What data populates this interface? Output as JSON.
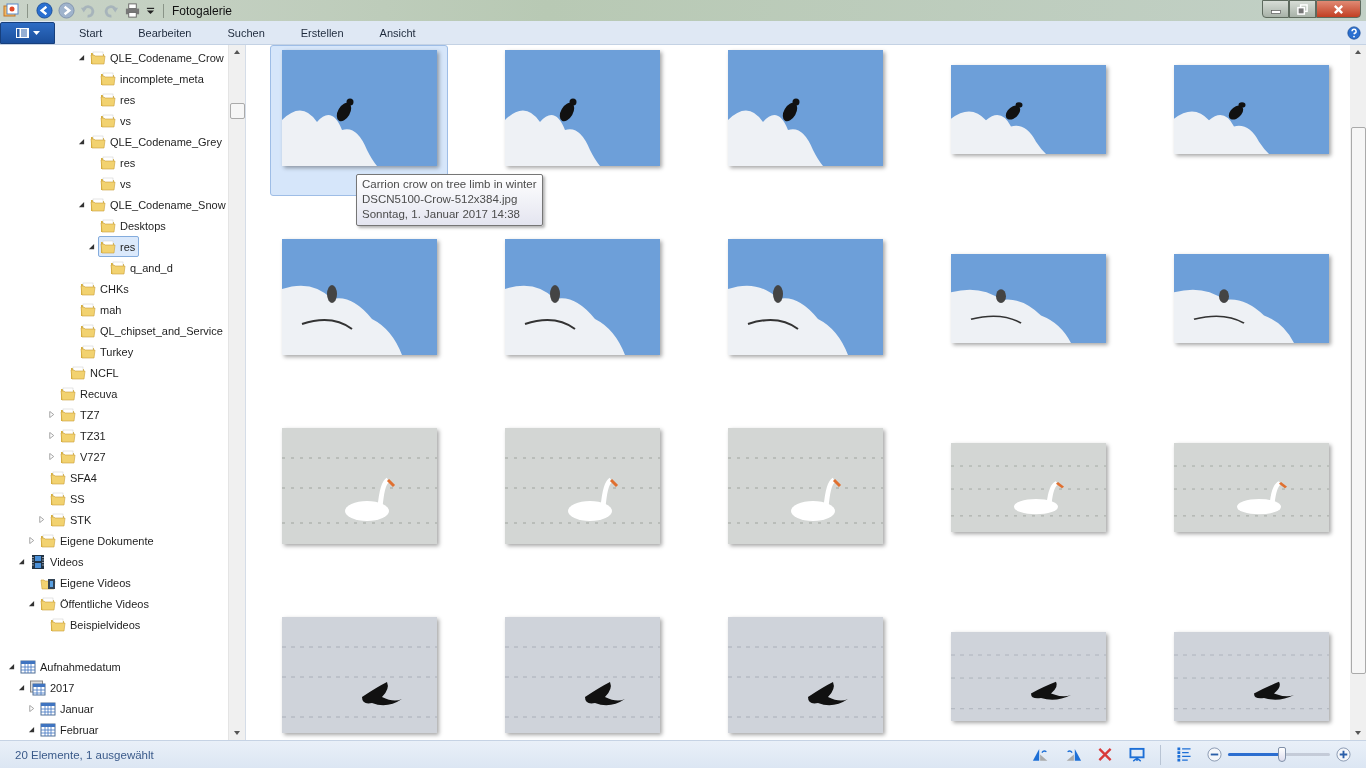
{
  "window": {
    "title": "Fotogalerie"
  },
  "menu": [
    "Start",
    "Bearbeiten",
    "Suchen",
    "Erstellen",
    "Ansicht"
  ],
  "sidebar": {
    "sections": [
      {
        "items": [
          {
            "children": [
              {
                "children": [
                  {
                    "children": [
                      {
                        "children": [
                          {
                            "children": [
                              {
                                "children": [
                                  {
                                    "children": [
                                      {
                                        "label": "QLE_Codename_Crow",
                                        "kind": "folder",
                                        "expanded": true,
                                        "selected": false,
                                        "children": [
                                          {
                                            "label": "incomplete_meta",
                                            "kind": "folder",
                                            "selected": false
                                          },
                                          {
                                            "label": "res",
                                            "kind": "folder",
                                            "selected": false
                                          },
                                          {
                                            "label": "vs",
                                            "kind": "folder",
                                            "selected": false
                                          }
                                        ]
                                      },
                                      {
                                        "label": "QLE_Codename_Grey",
                                        "kind": "folder",
                                        "expanded": true,
                                        "selected": false,
                                        "children": [
                                          {
                                            "label": "res",
                                            "kind": "folder",
                                            "selected": false
                                          },
                                          {
                                            "label": "vs",
                                            "kind": "folder",
                                            "selected": false
                                          }
                                        ]
                                      },
                                      {
                                        "label": "QLE_Codename_Snow",
                                        "kind": "folder",
                                        "expanded": true,
                                        "selected": false,
                                        "children": [
                                          {
                                            "label": "Desktops",
                                            "kind": "folder",
                                            "selected": false
                                          },
                                          {
                                            "label": "res",
                                            "kind": "folder",
                                            "expanded": true,
                                            "selected": true,
                                            "children": [
                                              {
                                                "label": "q_and_d",
                                                "kind": "folder",
                                                "selected": false
                                              }
                                            ]
                                          }
                                        ]
                                      }
                                    ]
                                  },
                                  {
                                    "label": "CHKs",
                                    "kind": "folder",
                                    "selected": false
                                  },
                                  {
                                    "label": "mah",
                                    "kind": "folder",
                                    "selected": false
                                  },
                                  {
                                    "label": "QL_chipset_and_Service",
                                    "kind": "folder",
                                    "selected": false
                                  },
                                  {
                                    "label": "Turkey",
                                    "kind": "folder",
                                    "selected": false
                                  }
                                ]
                              },
                              {
                                "label": "NCFL",
                                "kind": "folder",
                                "selected": false
                              }
                            ]
                          },
                          {
                            "label": "Recuva",
                            "kind": "folder",
                            "selected": false
                          },
                          {
                            "label": "TZ7",
                            "kind": "folder",
                            "expanded": false,
                            "selected": false
                          },
                          {
                            "label": "TZ31",
                            "kind": "folder",
                            "expanded": false,
                            "selected": false
                          },
                          {
                            "label": "V727",
                            "kind": "folder",
                            "expanded": false,
                            "selected": false
                          }
                        ]
                      },
                      {
                        "label": "SFA4",
                        "kind": "folder",
                        "selected": false
                      },
                      {
                        "label": "SS",
                        "kind": "folder",
                        "selected": false
                      },
                      {
                        "label": "STK",
                        "kind": "folder",
                        "expanded": false,
                        "selected": false
                      }
                    ]
                  },
                  {
                    "label": "Eigene Dokumente",
                    "kind": "folder",
                    "expanded": false,
                    "selected": false
                  }
                ]
              },
              {
                "label": "Videos",
                "kind": "video-library",
                "expanded": true,
                "selected": false,
                "children": [
                  {
                    "label": "Eigene Videos",
                    "kind": "video-folder",
                    "selected": false
                  },
                  {
                    "label": "Öffentliche Videos",
                    "kind": "folder",
                    "expanded": true,
                    "selected": false,
                    "children": [
                      {
                        "label": "Beispielvideos",
                        "kind": "folder",
                        "selected": false
                      }
                    ]
                  }
                ]
              }
            ]
          }
        ]
      },
      {
        "items": [
          {
            "label": "Aufnahmedatum",
            "kind": "calendar",
            "expanded": true,
            "selected": false,
            "children": [
              {
                "label": "2017",
                "kind": "calendar-stack",
                "expanded": true,
                "selected": false,
                "children": [
                  {
                    "label": "Januar",
                    "kind": "calendar",
                    "expanded": false,
                    "selected": false
                  },
                  {
                    "label": "Februar",
                    "kind": "calendar",
                    "expanded": true,
                    "selected": false
                  }
                ]
              }
            ]
          }
        ]
      }
    ]
  },
  "gallery": {
    "items": [
      {
        "kind": "crow-tree",
        "selected": true
      },
      {
        "kind": "crow-tree",
        "selected": false
      },
      {
        "kind": "crow-tree",
        "selected": false
      },
      {
        "kind": "crow-tree",
        "selected": false
      },
      {
        "kind": "crow-tree",
        "selected": false
      },
      {
        "kind": "crow-branch",
        "selected": false
      },
      {
        "kind": "crow-branch",
        "selected": false
      },
      {
        "kind": "crow-branch",
        "selected": false
      },
      {
        "kind": "crow-branch",
        "selected": false
      },
      {
        "kind": "crow-branch",
        "selected": false
      },
      {
        "kind": "swan",
        "selected": false
      },
      {
        "kind": "swan",
        "selected": false
      },
      {
        "kind": "swan",
        "selected": false
      },
      {
        "kind": "swan",
        "selected": false
      },
      {
        "kind": "swan",
        "selected": false
      },
      {
        "kind": "crow-flying",
        "selected": false
      },
      {
        "kind": "crow-flying",
        "selected": false
      },
      {
        "kind": "crow-flying",
        "selected": false
      },
      {
        "kind": "crow-flying",
        "selected": false
      },
      {
        "kind": "crow-flying",
        "selected": false
      }
    ],
    "tooltip": [
      "Carrion crow on tree limb in winter",
      "DSCN5100-Crow-512x384.jpg",
      "Sonntag, 1. Januar 2017 14:38"
    ]
  },
  "status_bar": {
    "text": "20 Elemente, 1 ausgewählt",
    "zoom": {
      "level": 0.53
    }
  }
}
